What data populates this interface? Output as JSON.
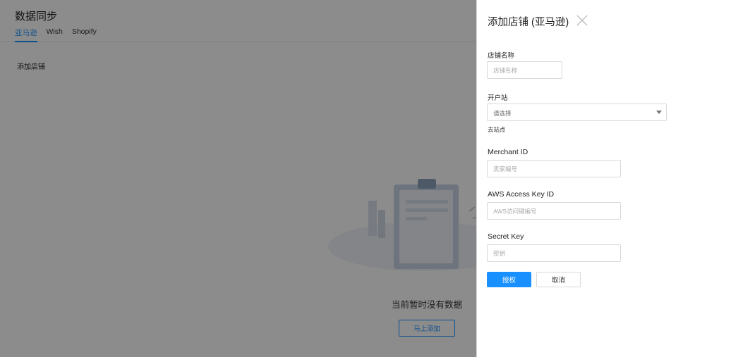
{
  "page": {
    "title": "数据同步",
    "tabs": [
      {
        "label": "亚马逊",
        "active": true
      },
      {
        "label": "Wish",
        "active": false
      },
      {
        "label": "Shopify",
        "active": false
      }
    ],
    "add_store_label": "添加店铺",
    "empty_text": "当前暂时没有数据",
    "empty_button": "马上添加"
  },
  "drawer": {
    "title": "添加店铺 (亚马逊)",
    "store_name": {
      "label": "店铺名称",
      "placeholder": "店铺名称"
    },
    "site": {
      "label": "开户站",
      "value": "请选择",
      "hint": "去站点"
    },
    "merchant_id": {
      "label": "Merchant ID",
      "placeholder": "卖家编号"
    },
    "aws_key": {
      "label": "AWS Access Key ID",
      "placeholder": "AWS访问键编号"
    },
    "secret_key": {
      "label": "Secret Key",
      "placeholder": "密钥"
    },
    "authorize_label": "授权",
    "cancel_label": "取消"
  },
  "colors": {
    "accent": "#1890ff",
    "mask": "rgba(0,0,0,0.45)"
  }
}
